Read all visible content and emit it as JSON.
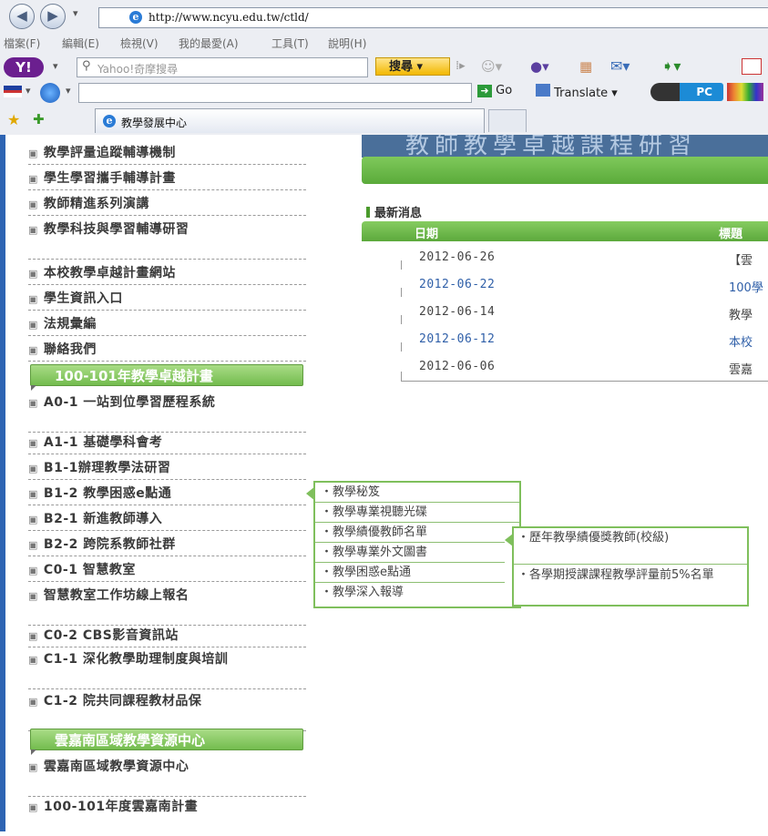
{
  "browser": {
    "url": "http://www.ncyu.edu.tw/ctld/",
    "menu": [
      "檔案(F)",
      "編輯(E)",
      "檢視(V)",
      "我的最愛(A)",
      "工具(T)",
      "說明(H)"
    ],
    "search_placeholder": "Yahoo!奇摩搜尋",
    "search_button": "搜尋",
    "go_label": "Go",
    "translate_label": "Translate",
    "pc_label": "PC",
    "tab_title": "教學發展中心"
  },
  "sidebar": {
    "items_top": [
      "教學評量追蹤輔導機制",
      "學生學習攜手輔導計畫",
      "教師精進系列演講",
      "教學科技與學習輔導研習",
      "本校教學卓越計畫網站",
      "學生資訊入口",
      "法規彙編",
      "聯絡我們"
    ],
    "section1_title": "100-101年教學卓越計畫",
    "items_mid": [
      "A0-1 一站到位學習歷程系統",
      "A1-1 基礎學科會考",
      "B1-1辦理教學法研習",
      "B1-2 教學困惑e點通",
      "B2-1 新進教師導入",
      "B2-2 跨院系教師社群",
      "C0-1 智慧教室",
      "智慧教室工作坊線上報名",
      "C0-2 CBS影音資訊站",
      "C1-1 深化教學助理制度與培訓",
      "C1-2 院共同課程教材品保"
    ],
    "section2_title": "雲嘉南區域教學資源中心",
    "items_bottom": [
      "雲嘉南區域教學資源中心",
      "100-101年度雲嘉南計畫"
    ]
  },
  "news": {
    "section_title": "最新消息",
    "col_date": "日期",
    "col_title": "標題",
    "rows": [
      {
        "date": "2012-06-26",
        "title": "【雲",
        "link": false
      },
      {
        "date": "2012-06-22",
        "title": "100學",
        "link": true
      },
      {
        "date": "2012-06-14",
        "title": "教學",
        "link": false
      },
      {
        "date": "2012-06-12",
        "title": "本校",
        "link": true
      },
      {
        "date": "2012-06-06",
        "title": "雲嘉",
        "link": false
      }
    ]
  },
  "popup1": [
    "・教學秘笈",
    "・教學專業視聽光碟",
    "・教學績優教師名單",
    "・教學專業外文圖書",
    "・教學困惑e點通",
    "・教學深入報導"
  ],
  "popup2": [
    "・歷年教學績優獎教師(校級)",
    "・各學期授課課程教學評量前5%名單"
  ],
  "colors": {
    "accent_green": "#6ab547",
    "link_blue": "#2f5fa8",
    "sidebar_rule": "#2e64b3"
  }
}
